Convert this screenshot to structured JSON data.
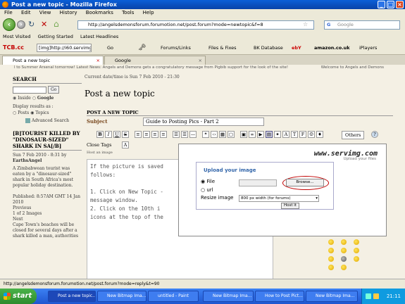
{
  "window": {
    "title": "Post a new topic - Mozilla Firefox"
  },
  "menu": [
    "File",
    "Edit",
    "View",
    "History",
    "Bookmarks",
    "Tools",
    "Help"
  ],
  "nav": {
    "url": "http://angelsdemonsforum.forumotion.net/post.forum?mode=newtopic&f=8",
    "search_placeholder": "Google"
  },
  "bookmarks": [
    "Most Visited",
    "Getting Started",
    "Latest Headlines"
  ],
  "toolbar2": {
    "brand": "TCB.cc",
    "field": "[img]http://i60.servimg.co",
    "go": "Go",
    "items": [
      "Forums/Links",
      "Files & Fixes",
      "BK Database",
      "ebY",
      "amazon.co.uk",
      "iPlayers"
    ]
  },
  "tabs": [
    "Post a new topic",
    "Google"
  ],
  "page": {
    "ticker_left": "l to Summer Arsenal tomorrow! Latest News: Angels and Demons gets a congratulatory message from Pigbib support for the look of the site!",
    "ticker_right": "Welcome to Angels and Demons",
    "datetime": "Current date/time is Sun 7 Feb 2010 - 21:30",
    "title": "Post a new topic",
    "section_header": "POST A NEW TOPIC",
    "subject_label": "Subject",
    "subject_value": "Guide to Posting Pics - Part 2",
    "others_label": "Others",
    "close_tags": "Close Tags",
    "host_image": "Host an image",
    "editor_lines": [
      "If the picture is saved",
      "follows:",
      "",
      "1. Click on New Topic -",
      "message window.",
      "2. Click on the 10th i",
      "icons at the top of the"
    ]
  },
  "sidebar": {
    "search_title": "SEARCH",
    "go": "Go",
    "radio_inside": "Inside",
    "radio_google": "Google",
    "display_label": "Display results as :",
    "radio_posts": "Posts",
    "radio_topics": "Topics",
    "advanced": "Advanced Search",
    "news_title": "[B]TOURIST KILLED BY \"DINOSAUR-SIZED\" SHARK IN SA[/B]",
    "news_date": "Sun 7 Feb 2010 - 8:31 by",
    "news_author": "EarthsAngel",
    "news_body": "A Zimbabwean tourist was eaten by a \"dinosaur-sized\" shark in South Africa's most popular holiday destination.",
    "published": "Published: 8:57AM GMT 14 Jan 2010",
    "previous": "Previous",
    "pager": "1 of 2 Images",
    "next": "Next",
    "more": "Cape Town's beaches will be closed for several days after a shark killed a man, authorities"
  },
  "popup": {
    "brand": "www.servimg.com",
    "tagline": "Upload your files",
    "upload_title": "Upload your image",
    "file_label": "File",
    "url_label": "url",
    "browse": "Browse...",
    "resize_label": "Resize image",
    "resize_value": "800 px width (for forums)",
    "host_button": "Host it"
  },
  "status": {
    "text": "http://angelsdemonsforum.forumotion.net/post.forum?mode=reply&t=90"
  },
  "taskbar": {
    "start": "start",
    "tasks": [
      "Post a new topic...",
      "New Bitmap Ima...",
      "untitled - Paint",
      "New Bitmap Ima...",
      "How to Post Pict...",
      "New Bitmap Ima..."
    ],
    "clock": "21:11"
  },
  "colors": {
    "titlebar": "#0a5fd8",
    "taskbar": "#245edb",
    "start": "#3b9e3b",
    "highlight_circle": "#c00000",
    "link_blue": "#1f4fa0"
  }
}
